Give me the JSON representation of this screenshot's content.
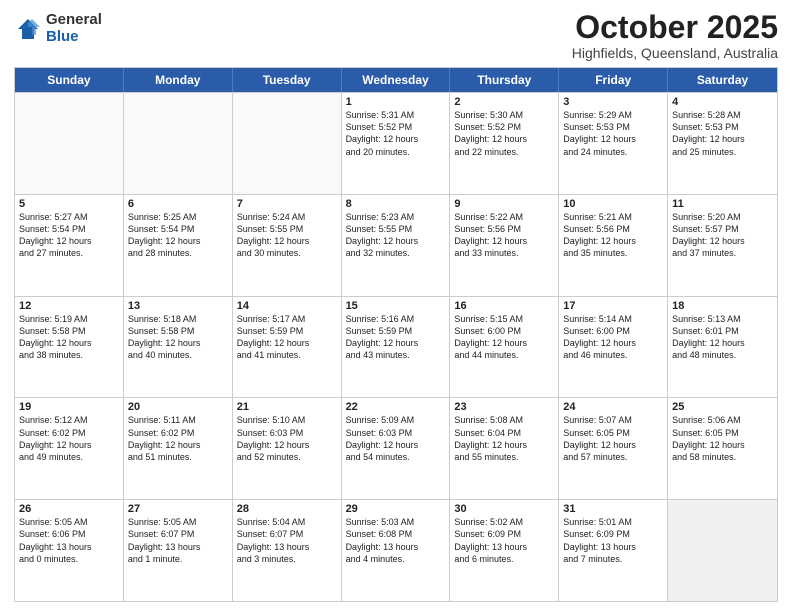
{
  "logo": {
    "general": "General",
    "blue": "Blue"
  },
  "title": "October 2025",
  "subtitle": "Highfields, Queensland, Australia",
  "headers": [
    "Sunday",
    "Monday",
    "Tuesday",
    "Wednesday",
    "Thursday",
    "Friday",
    "Saturday"
  ],
  "rows": [
    [
      {
        "day": "",
        "text": "",
        "empty": true
      },
      {
        "day": "",
        "text": "",
        "empty": true
      },
      {
        "day": "",
        "text": "",
        "empty": true
      },
      {
        "day": "1",
        "text": "Sunrise: 5:31 AM\nSunset: 5:52 PM\nDaylight: 12 hours\nand 20 minutes."
      },
      {
        "day": "2",
        "text": "Sunrise: 5:30 AM\nSunset: 5:52 PM\nDaylight: 12 hours\nand 22 minutes."
      },
      {
        "day": "3",
        "text": "Sunrise: 5:29 AM\nSunset: 5:53 PM\nDaylight: 12 hours\nand 24 minutes."
      },
      {
        "day": "4",
        "text": "Sunrise: 5:28 AM\nSunset: 5:53 PM\nDaylight: 12 hours\nand 25 minutes."
      }
    ],
    [
      {
        "day": "5",
        "text": "Sunrise: 5:27 AM\nSunset: 5:54 PM\nDaylight: 12 hours\nand 27 minutes."
      },
      {
        "day": "6",
        "text": "Sunrise: 5:25 AM\nSunset: 5:54 PM\nDaylight: 12 hours\nand 28 minutes."
      },
      {
        "day": "7",
        "text": "Sunrise: 5:24 AM\nSunset: 5:55 PM\nDaylight: 12 hours\nand 30 minutes."
      },
      {
        "day": "8",
        "text": "Sunrise: 5:23 AM\nSunset: 5:55 PM\nDaylight: 12 hours\nand 32 minutes."
      },
      {
        "day": "9",
        "text": "Sunrise: 5:22 AM\nSunset: 5:56 PM\nDaylight: 12 hours\nand 33 minutes."
      },
      {
        "day": "10",
        "text": "Sunrise: 5:21 AM\nSunset: 5:56 PM\nDaylight: 12 hours\nand 35 minutes."
      },
      {
        "day": "11",
        "text": "Sunrise: 5:20 AM\nSunset: 5:57 PM\nDaylight: 12 hours\nand 37 minutes."
      }
    ],
    [
      {
        "day": "12",
        "text": "Sunrise: 5:19 AM\nSunset: 5:58 PM\nDaylight: 12 hours\nand 38 minutes."
      },
      {
        "day": "13",
        "text": "Sunrise: 5:18 AM\nSunset: 5:58 PM\nDaylight: 12 hours\nand 40 minutes."
      },
      {
        "day": "14",
        "text": "Sunrise: 5:17 AM\nSunset: 5:59 PM\nDaylight: 12 hours\nand 41 minutes."
      },
      {
        "day": "15",
        "text": "Sunrise: 5:16 AM\nSunset: 5:59 PM\nDaylight: 12 hours\nand 43 minutes."
      },
      {
        "day": "16",
        "text": "Sunrise: 5:15 AM\nSunset: 6:00 PM\nDaylight: 12 hours\nand 44 minutes."
      },
      {
        "day": "17",
        "text": "Sunrise: 5:14 AM\nSunset: 6:00 PM\nDaylight: 12 hours\nand 46 minutes."
      },
      {
        "day": "18",
        "text": "Sunrise: 5:13 AM\nSunset: 6:01 PM\nDaylight: 12 hours\nand 48 minutes."
      }
    ],
    [
      {
        "day": "19",
        "text": "Sunrise: 5:12 AM\nSunset: 6:02 PM\nDaylight: 12 hours\nand 49 minutes."
      },
      {
        "day": "20",
        "text": "Sunrise: 5:11 AM\nSunset: 6:02 PM\nDaylight: 12 hours\nand 51 minutes."
      },
      {
        "day": "21",
        "text": "Sunrise: 5:10 AM\nSunset: 6:03 PM\nDaylight: 12 hours\nand 52 minutes."
      },
      {
        "day": "22",
        "text": "Sunrise: 5:09 AM\nSunset: 6:03 PM\nDaylight: 12 hours\nand 54 minutes."
      },
      {
        "day": "23",
        "text": "Sunrise: 5:08 AM\nSunset: 6:04 PM\nDaylight: 12 hours\nand 55 minutes."
      },
      {
        "day": "24",
        "text": "Sunrise: 5:07 AM\nSunset: 6:05 PM\nDaylight: 12 hours\nand 57 minutes."
      },
      {
        "day": "25",
        "text": "Sunrise: 5:06 AM\nSunset: 6:05 PM\nDaylight: 12 hours\nand 58 minutes."
      }
    ],
    [
      {
        "day": "26",
        "text": "Sunrise: 5:05 AM\nSunset: 6:06 PM\nDaylight: 13 hours\nand 0 minutes."
      },
      {
        "day": "27",
        "text": "Sunrise: 5:05 AM\nSunset: 6:07 PM\nDaylight: 13 hours\nand 1 minute."
      },
      {
        "day": "28",
        "text": "Sunrise: 5:04 AM\nSunset: 6:07 PM\nDaylight: 13 hours\nand 3 minutes."
      },
      {
        "day": "29",
        "text": "Sunrise: 5:03 AM\nSunset: 6:08 PM\nDaylight: 13 hours\nand 4 minutes."
      },
      {
        "day": "30",
        "text": "Sunrise: 5:02 AM\nSunset: 6:09 PM\nDaylight: 13 hours\nand 6 minutes."
      },
      {
        "day": "31",
        "text": "Sunrise: 5:01 AM\nSunset: 6:09 PM\nDaylight: 13 hours\nand 7 minutes."
      },
      {
        "day": "",
        "text": "",
        "empty": true,
        "shaded": true
      }
    ]
  ]
}
